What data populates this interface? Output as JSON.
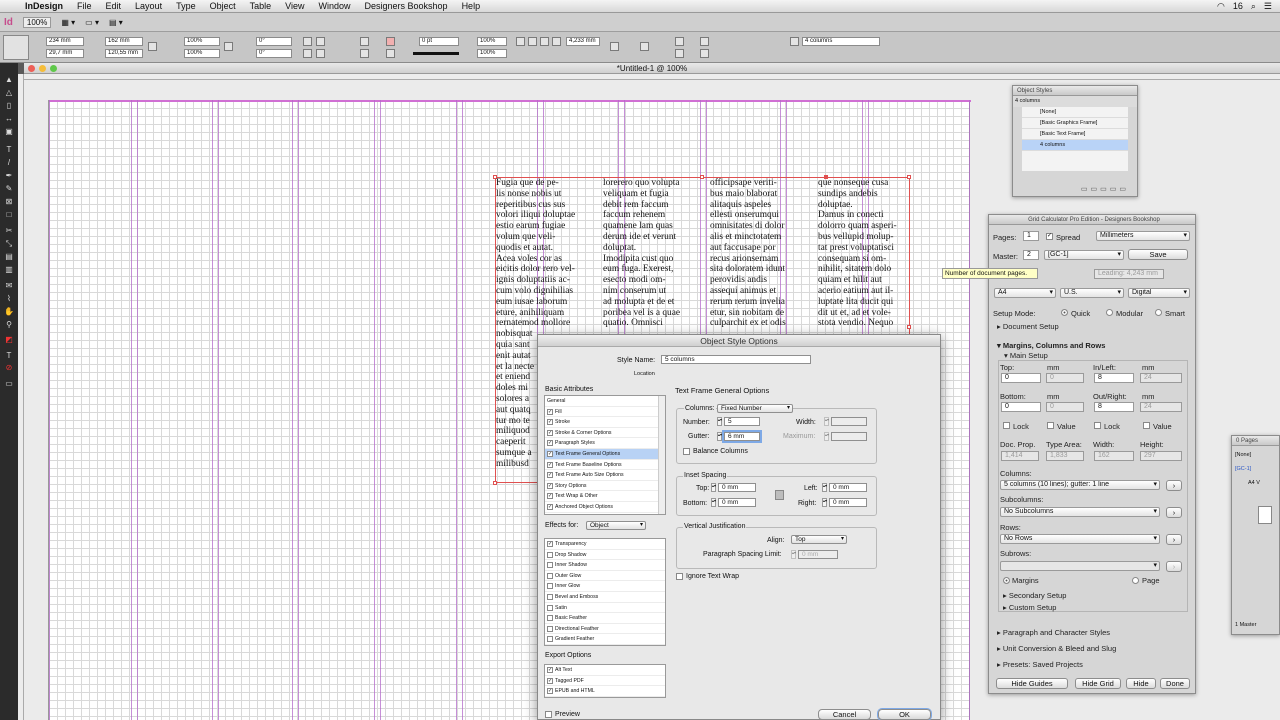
{
  "menubar": {
    "apple": "",
    "items": [
      "InDesign",
      "File",
      "Edit",
      "Layout",
      "Type",
      "Object",
      "Table",
      "View",
      "Window",
      "Designers Bookshop",
      "Help"
    ],
    "right_status": "16"
  },
  "appbar": {
    "logo": "Id",
    "zoom": "100%"
  },
  "control": {
    "x": "234 mm",
    "y": "29,7 mm",
    "w": "162 mm",
    "h": "120,55 mm",
    "scale_x": "100%",
    "scale_y": "100%",
    "angle": "0°",
    "shear": "0°",
    "stroke": "0 pt",
    "scale_a": "100%",
    "scale_b": "100%",
    "gutter": "4,233 mm",
    "columns": "4 columns"
  },
  "document": {
    "title": "*Untitled-1 @ 100%"
  },
  "text_columns": [
    [
      "Fugia que de pe-",
      "lis nonse nobis ut",
      "reperitibus cus sus",
      "volori iliqui doluptae",
      "estio earum fugiae",
      "volum que veli-",
      "quodis et autat.",
      "Acea voles cor as",
      "eicitis dolor rero vel-",
      "ignis doluptatiis ac-",
      "cum volo dignihilias",
      "eum iusae laborum",
      "eture, anihiliquam",
      "rernatemod mollore",
      "nobisquat",
      "quia sant",
      "enit autat",
      "et la necte",
      "et eniend",
      "doles mi",
      "solores a",
      "aut quatq",
      "tur mo te",
      "miliquod",
      "caeperit",
      "sumque a",
      "milibusd"
    ],
    [
      "lorerero quo volupta",
      "veliquam et fugia",
      "debit rem faccum",
      "faccum rehenem",
      "quamene lam quas",
      "derum ide et verunt",
      "doluptat.",
      "Imodipita cust quo",
      "eum fuga. Exerest,",
      "esecto modi om-",
      "nim conserum ut",
      "ad molupta et de et",
      "poribea vel is a quae",
      "quatio. Omnisci"
    ],
    [
      "officipsape veriti-",
      "bus maio blaborat",
      "alitaquis aspeles",
      "ellesti onserumqui",
      "omnisitates di dolor",
      "alis et minctotatem",
      "aut faccusape por",
      "recus arionsernam",
      "sita doloratem idunt",
      "perovidis andis",
      "assequi animus et",
      "rerum rerum invelia",
      "etur, sin nobitam de",
      "culparchit ex et odis"
    ],
    [
      "que nonseque cusa",
      "sundips andebis",
      "doluptae.",
      "Damus in conecti",
      "dolorro quam asperi-",
      "bus vellupid molup-",
      "tat prest voluptatisci",
      "consequam si om-",
      "nihilit, sitatem dolo",
      "quiam et hilit aut",
      "acerio eatium aut il-",
      "luptate lita ducit qui",
      "dit ut et, ad et vole-",
      "stota vendio. Nequo"
    ]
  ],
  "object_styles": {
    "title": "Object Styles",
    "current": "4 columns",
    "items": [
      "[None]",
      "[Basic Graphics Frame]",
      "[Basic Text Frame]",
      "4 columns"
    ]
  },
  "grid_calc": {
    "title": "Grid Calculator Pro Edition - Designers Bookshop",
    "pages_label": "Pages:",
    "pages": "1",
    "spread": "Spread",
    "units": "Millimeters",
    "master_label": "Master:",
    "master": "2",
    "master_name": "[GC-1]",
    "save": "Save",
    "tooltip": "Number of document pages.",
    "leading": "Leading: 4,243 mm",
    "paper": "A4",
    "paper2": "U.S.",
    "output": "Digital",
    "setup_mode": "Setup Mode:",
    "quick": "Quick",
    "modular": "Modular",
    "smart": "Smart",
    "document_setup": "Document Setup",
    "mcr": "Margins, Columns and Rows",
    "main_setup": "Main Setup",
    "top": "Top:",
    "mm": "mm",
    "inleft": "In/Left:",
    "top_val": "0",
    "top_val2": "0",
    "inleft_val": "8",
    "inleft_val2": "24",
    "bottom": "Bottom:",
    "outright": "Out/Right:",
    "bottom_val": "0",
    "bottom_val2": "0",
    "outright_val": "8",
    "outright_val2": "24",
    "lock": "Lock",
    "value": "Value",
    "docprop": "Doc. Prop.",
    "typearea": "Type Area:",
    "width": "Width:",
    "height": "Height:",
    "docprop_val": "1,414",
    "typearea_val": "1,833",
    "width_val": "162",
    "height_val": "297",
    "columns_label": "Columns:",
    "columns_val": "5 columns (10 lines); gutter: 1 line",
    "subcolumns_label": "Subcolumns:",
    "subcolumns_val": "No Subcolumns",
    "rows_label": "Rows:",
    "rows_val": "No Rows",
    "subrows_label": "Subrows:",
    "margins": "Margins",
    "page": "Page",
    "secondary": "Secondary Setup",
    "custom": "Custom Setup",
    "para": "Paragraph and Character Styles",
    "unit": "Unit Conversion & Bleed and Slug",
    "presets": "Presets: Saved Projects",
    "hide_guides": "Hide Guides",
    "hide_grid": "Hide Grid",
    "hide": "Hide",
    "done": "Done"
  },
  "pages_panel": {
    "title": "0 Pages",
    "none": "[None]",
    "gc": "[GC-1]",
    "av": "A4 V",
    "footer": "1 Master"
  },
  "dialog": {
    "title": "Object Style Options",
    "style_name_label": "Style Name:",
    "style_name": "5 columns",
    "location": "Location",
    "basic_attributes": "Basic Attributes",
    "basic_items": [
      {
        "label": "General",
        "check": false
      },
      {
        "label": "Fill",
        "check": true
      },
      {
        "label": "Stroke",
        "check": true
      },
      {
        "label": "Stroke & Corner Options",
        "check": true
      },
      {
        "label": "Paragraph Styles",
        "check": true
      },
      {
        "label": "Text Frame General Options",
        "check": true
      },
      {
        "label": "Text Frame Baseline Options",
        "check": true
      },
      {
        "label": "Text Frame Auto Size Options",
        "check": true
      },
      {
        "label": "Story Options",
        "check": true
      },
      {
        "label": "Text Wrap & Other",
        "check": true
      },
      {
        "label": "Anchored Object Options",
        "check": true
      }
    ],
    "effects_for_label": "Effects for:",
    "effects_for": "Object",
    "effects_items": [
      {
        "label": "Transparency",
        "check": true
      },
      {
        "label": "Drop Shadow",
        "check": false
      },
      {
        "label": "Inner Shadow",
        "check": false
      },
      {
        "label": "Outer Glow",
        "check": false
      },
      {
        "label": "Inner Glow",
        "check": false
      },
      {
        "label": "Bevel and Emboss",
        "check": false
      },
      {
        "label": "Satin",
        "check": false
      },
      {
        "label": "Basic Feather",
        "check": false
      },
      {
        "label": "Directional Feather",
        "check": false
      },
      {
        "label": "Gradient Feather",
        "check": false
      }
    ],
    "export_options": "Export Options",
    "export_items": [
      {
        "label": "Alt Text",
        "check": true
      },
      {
        "label": "Tagged PDF",
        "check": true
      },
      {
        "label": "EPUB and HTML",
        "check": true
      }
    ],
    "preview": "Preview",
    "section": "Text Frame General Options",
    "columns_label": "Columns:",
    "columns_type": "Fixed Number",
    "number_label": "Number:",
    "number": "5",
    "width_label": "Width:",
    "gutter_label": "Gutter:",
    "gutter": "6 mm",
    "maximum_label": "Maximum:",
    "balance": "Balance Columns",
    "inset": "Inset Spacing",
    "inset_top_label": "Top:",
    "inset_top": "0 mm",
    "inset_bottom_label": "Bottom:",
    "inset_bottom": "0 mm",
    "inset_left_label": "Left:",
    "inset_left": "0 mm",
    "inset_right_label": "Right:",
    "inset_right": "0 mm",
    "vj": "Vertical Justification",
    "align_label": "Align:",
    "align": "Top",
    "psl_label": "Paragraph Spacing Limit:",
    "psl": "0 mm",
    "ignore_wrap": "Ignore Text Wrap",
    "cancel": "Cancel",
    "ok": "OK"
  }
}
